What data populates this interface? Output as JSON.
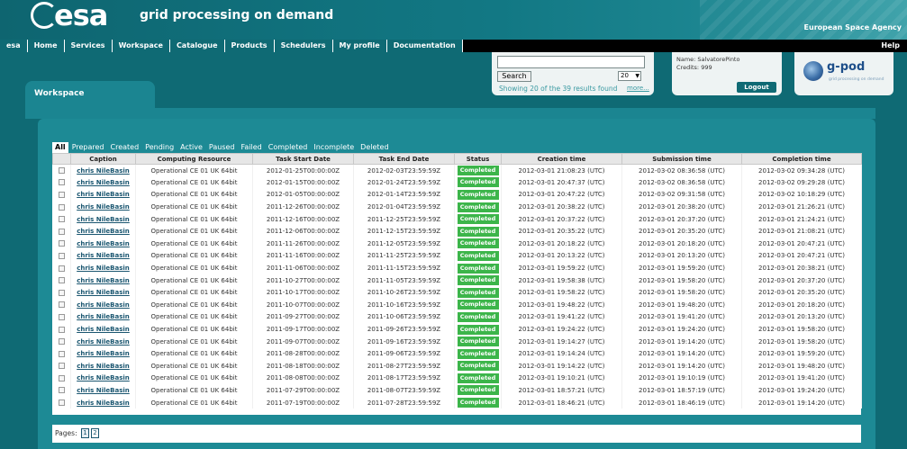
{
  "header": {
    "logo_text": "esa",
    "tagline": "grid processing on demand",
    "agency": "European Space Agency"
  },
  "nav": {
    "items": [
      "esa",
      "Home",
      "Services",
      "Workspace",
      "Catalogue",
      "Products",
      "Schedulers",
      "My profile",
      "Documentation"
    ],
    "help": "Help"
  },
  "search": {
    "value": "",
    "button_label": "Search",
    "page_size": "20",
    "results_text": "Showing 20 of the 39 results found",
    "more_label": "more..."
  },
  "user": {
    "name": "Name: SalvatorePinto",
    "credits": "Credits: 999",
    "logout_label": "Logout"
  },
  "gpod": {
    "title": "g-pod",
    "subtitle": "grid processing on demand"
  },
  "workspace": {
    "title": "Workspace",
    "status_tabs": [
      "All",
      "Prepared",
      "Created",
      "Pending",
      "Active",
      "Paused",
      "Failed",
      "Completed",
      "Incomplete",
      "Deleted"
    ],
    "active_tab": "All"
  },
  "table": {
    "columns": [
      "",
      "Caption",
      "Computing Resource",
      "Task Start Date",
      "Task End Date",
      "Status",
      "Creation time",
      "Submission time",
      "Completion time"
    ],
    "rows": [
      [
        "chris NileBasin",
        "Operational CE 01 UK 64bit",
        "2012-01-25T00:00:00Z",
        "2012-02-03T23:59:59Z",
        "Completed",
        "2012-03-01 21:08:23 (UTC)",
        "2012-03-02 08:36:58 (UTC)",
        "2012-03-02 09:34:28 (UTC)"
      ],
      [
        "chris NileBasin",
        "Operational CE 01 UK 64bit",
        "2012-01-15T00:00:00Z",
        "2012-01-24T23:59:59Z",
        "Completed",
        "2012-03-01 20:47:37 (UTC)",
        "2012-03-02 08:36:58 (UTC)",
        "2012-03-02 09:29:28 (UTC)"
      ],
      [
        "chris NileBasin",
        "Operational CE 01 UK 64bit",
        "2012-01-05T00:00:00Z",
        "2012-01-14T23:59:59Z",
        "Completed",
        "2012-03-01 20:47:22 (UTC)",
        "2012-03-02 09:31:58 (UTC)",
        "2012-03-02 10:18:29 (UTC)"
      ],
      [
        "chris NileBasin",
        "Operational CE 01 UK 64bit",
        "2011-12-26T00:00:00Z",
        "2012-01-04T23:59:59Z",
        "Completed",
        "2012-03-01 20:38:22 (UTC)",
        "2012-03-01 20:38:20 (UTC)",
        "2012-03-01 21:26:21 (UTC)"
      ],
      [
        "chris NileBasin",
        "Operational CE 01 UK 64bit",
        "2011-12-16T00:00:00Z",
        "2011-12-25T23:59:59Z",
        "Completed",
        "2012-03-01 20:37:22 (UTC)",
        "2012-03-01 20:37:20 (UTC)",
        "2012-03-01 21:24:21 (UTC)"
      ],
      [
        "chris NileBasin",
        "Operational CE 01 UK 64bit",
        "2011-12-06T00:00:00Z",
        "2011-12-15T23:59:59Z",
        "Completed",
        "2012-03-01 20:35:22 (UTC)",
        "2012-03-01 20:35:20 (UTC)",
        "2012-03-01 21:08:21 (UTC)"
      ],
      [
        "chris NileBasin",
        "Operational CE 01 UK 64bit",
        "2011-11-26T00:00:00Z",
        "2011-12-05T23:59:59Z",
        "Completed",
        "2012-03-01 20:18:22 (UTC)",
        "2012-03-01 20:18:20 (UTC)",
        "2012-03-01 20:47:21 (UTC)"
      ],
      [
        "chris NileBasin",
        "Operational CE 01 UK 64bit",
        "2011-11-16T00:00:00Z",
        "2011-11-25T23:59:59Z",
        "Completed",
        "2012-03-01 20:13:22 (UTC)",
        "2012-03-01 20:13:20 (UTC)",
        "2012-03-01 20:47:21 (UTC)"
      ],
      [
        "chris NileBasin",
        "Operational CE 01 UK 64bit",
        "2011-11-06T00:00:00Z",
        "2011-11-15T23:59:59Z",
        "Completed",
        "2012-03-01 19:59:22 (UTC)",
        "2012-03-01 19:59:20 (UTC)",
        "2012-03-01 20:38:21 (UTC)"
      ],
      [
        "chris NileBasin",
        "Operational CE 01 UK 64bit",
        "2011-10-27T00:00:00Z",
        "2011-11-05T23:59:59Z",
        "Completed",
        "2012-03-01 19:58:38 (UTC)",
        "2012-03-01 19:58:20 (UTC)",
        "2012-03-01 20:37:20 (UTC)"
      ],
      [
        "chris NileBasin",
        "Operational CE 01 UK 64bit",
        "2011-10-17T00:00:00Z",
        "2011-10-26T23:59:59Z",
        "Completed",
        "2012-03-01 19:58:22 (UTC)",
        "2012-03-01 19:58:20 (UTC)",
        "2012-03-01 20:35:20 (UTC)"
      ],
      [
        "chris NileBasin",
        "Operational CE 01 UK 64bit",
        "2011-10-07T00:00:00Z",
        "2011-10-16T23:59:59Z",
        "Completed",
        "2012-03-01 19:48:22 (UTC)",
        "2012-03-01 19:48:20 (UTC)",
        "2012-03-01 20:18:20 (UTC)"
      ],
      [
        "chris NileBasin",
        "Operational CE 01 UK 64bit",
        "2011-09-27T00:00:00Z",
        "2011-10-06T23:59:59Z",
        "Completed",
        "2012-03-01 19:41:22 (UTC)",
        "2012-03-01 19:41:20 (UTC)",
        "2012-03-01 20:13:20 (UTC)"
      ],
      [
        "chris NileBasin",
        "Operational CE 01 UK 64bit",
        "2011-09-17T00:00:00Z",
        "2011-09-26T23:59:59Z",
        "Completed",
        "2012-03-01 19:24:22 (UTC)",
        "2012-03-01 19:24:20 (UTC)",
        "2012-03-01 19:58:20 (UTC)"
      ],
      [
        "chris NileBasin",
        "Operational CE 01 UK 64bit",
        "2011-09-07T00:00:00Z",
        "2011-09-16T23:59:59Z",
        "Completed",
        "2012-03-01 19:14:27 (UTC)",
        "2012-03-01 19:14:20 (UTC)",
        "2012-03-01 19:58:20 (UTC)"
      ],
      [
        "chris NileBasin",
        "Operational CE 01 UK 64bit",
        "2011-08-28T00:00:00Z",
        "2011-09-06T23:59:59Z",
        "Completed",
        "2012-03-01 19:14:24 (UTC)",
        "2012-03-01 19:14:20 (UTC)",
        "2012-03-01 19:59:20 (UTC)"
      ],
      [
        "chris NileBasin",
        "Operational CE 01 UK 64bit",
        "2011-08-18T00:00:00Z",
        "2011-08-27T23:59:59Z",
        "Completed",
        "2012-03-01 19:14:22 (UTC)",
        "2012-03-01 19:14:20 (UTC)",
        "2012-03-01 19:48:20 (UTC)"
      ],
      [
        "chris NileBasin",
        "Operational CE 01 UK 64bit",
        "2011-08-08T00:00:00Z",
        "2011-08-17T23:59:59Z",
        "Completed",
        "2012-03-01 19:10:21 (UTC)",
        "2012-03-01 19:10:19 (UTC)",
        "2012-03-01 19:41:20 (UTC)"
      ],
      [
        "chris NileBasin",
        "Operational CE 01 UK 64bit",
        "2011-07-29T00:00:00Z",
        "2011-08-07T23:59:59Z",
        "Completed",
        "2012-03-01 18:57:21 (UTC)",
        "2012-03-01 18:57:19 (UTC)",
        "2012-03-01 19:24:20 (UTC)"
      ],
      [
        "chris NileBasin",
        "Operational CE 01 UK 64bit",
        "2011-07-19T00:00:00Z",
        "2011-07-28T23:59:59Z",
        "Completed",
        "2012-03-01 18:46:21 (UTC)",
        "2012-03-01 18:46:19 (UTC)",
        "2012-03-01 19:14:20 (UTC)"
      ]
    ]
  },
  "pager": {
    "label": "Pages:",
    "pages": [
      "1",
      "2"
    ],
    "current": "1"
  },
  "colors": {
    "brand_teal": "#0f6a74",
    "panel_teal": "#1b8591",
    "completed_green": "#3cb54a",
    "nav_black": "#000000"
  }
}
